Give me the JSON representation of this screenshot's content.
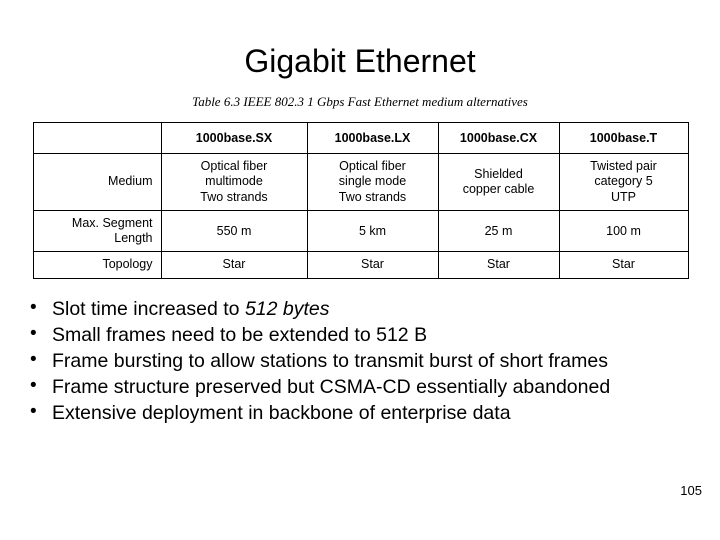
{
  "slide": {
    "title": "Gigabit Ethernet",
    "table_caption": "Table 6.3  IEEE 802.3 1 Gbps Fast Ethernet medium alternatives",
    "page_number": "105"
  },
  "table": {
    "corner_label": "",
    "columns": [
      "1000base.SX",
      "1000base.LX",
      "1000base.CX",
      "1000base.T"
    ],
    "rows": [
      {
        "header": "Medium",
        "cells": [
          "Optical fiber\nmultimode\nTwo strands",
          "Optical fiber\nsingle mode\nTwo strands",
          "Shielded\ncopper cable",
          "Twisted pair\ncategory 5\nUTP"
        ]
      },
      {
        "header": "Max. Segment Length",
        "cells": [
          "550 m",
          "5 km",
          "25 m",
          "100 m"
        ]
      },
      {
        "header": "Topology",
        "cells": [
          "Star",
          "Star",
          "Star",
          "Star"
        ]
      }
    ]
  },
  "bullets": [
    {
      "pre": "Slot time increased to ",
      "em": "512 bytes",
      "post": ""
    },
    {
      "pre": "Small frames need to be extended to 512 B",
      "em": "",
      "post": ""
    },
    {
      "pre": "Frame bursting to allow stations to transmit burst of short frames",
      "em": "",
      "post": ""
    },
    {
      "pre": "Frame structure preserved but CSMA-CD essentially abandoned",
      "em": "",
      "post": ""
    },
    {
      "pre": "Extensive deployment in backbone of enterprise data",
      "em": "",
      "post": ""
    }
  ]
}
